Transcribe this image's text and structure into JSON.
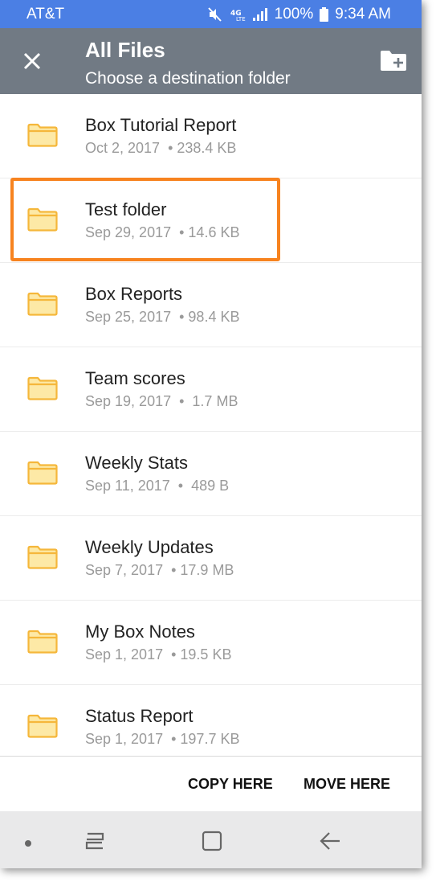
{
  "status_bar": {
    "carrier": "AT&T",
    "battery": "100%",
    "time": "9:34 AM",
    "icons": [
      "mute-icon",
      "lte-icon",
      "signal-icon",
      "battery-icon"
    ]
  },
  "header": {
    "title": "All Files",
    "subtitle": "Choose a destination folder",
    "close_icon": "close-icon",
    "new_folder_icon": "new-folder-icon"
  },
  "folders": [
    {
      "name": "Box Tutorial Report",
      "date": "Oct 2, 2017",
      "size": "238.4 KB"
    },
    {
      "name": "Test folder",
      "date": "Sep 29, 2017",
      "size": "14.6 KB",
      "highlighted": true
    },
    {
      "name": "Box Reports",
      "date": "Sep 25, 2017",
      "size": "98.4 KB"
    },
    {
      "name": "Team scores",
      "date": "Sep 19, 2017",
      "size": "1.7 MB"
    },
    {
      "name": "Weekly Stats",
      "date": "Sep 11, 2017",
      "size": "489 B"
    },
    {
      "name": "Weekly Updates",
      "date": "Sep 7, 2017",
      "size": "17.9 MB"
    },
    {
      "name": "My Box Notes",
      "date": "Sep 1, 2017",
      "size": "19.5 KB"
    },
    {
      "name": "Status Report",
      "date": "Sep 1, 2017",
      "size": "197.7 KB"
    }
  ],
  "actions": {
    "copy_label": "COPY HERE",
    "move_label": "MOVE HERE"
  },
  "colors": {
    "status_bar": "#4b7fe4",
    "header": "#717a84",
    "highlight": "#f7831f",
    "folder": "#f5b73b",
    "folder_fill": "#fde9a6"
  }
}
